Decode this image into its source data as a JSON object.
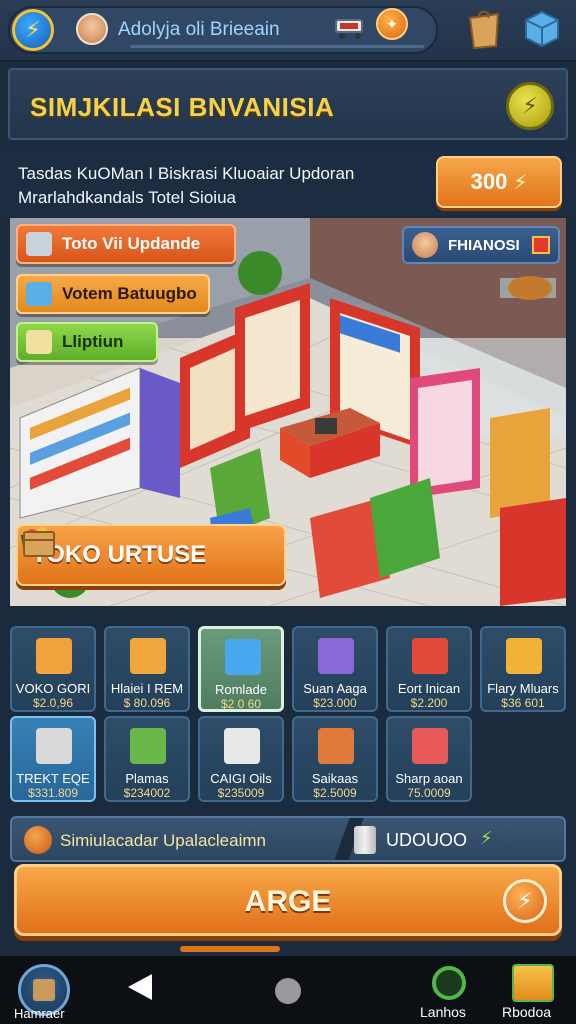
{
  "topbar": {
    "user_name": "Adolyja oli Brieeain",
    "coin_glyph": "⚡"
  },
  "header": {
    "title": "SIMJKILASI BNVANISIA",
    "badge_glyph": "⚡"
  },
  "info": {
    "line1": "Tasdas KuOMan I Biskrasi Kluoaiar Updoran",
    "line2": "Mrarlahdkandals Totel Sioiua",
    "price": "300",
    "price_glyph": "⚡"
  },
  "scene": {
    "buttons": [
      {
        "label": "Toto Vii Updande"
      },
      {
        "label": "Votem Batuugbo"
      },
      {
        "label": "Lliptiun"
      }
    ],
    "friend_label": "FHIANOSI",
    "toko_label": "TOKO URTUSE"
  },
  "items": [
    {
      "name": "VOKO GORI",
      "price": "$2.0,96",
      "color": "#f2a23a"
    },
    {
      "name": "Hlaiei I REM",
      "price": "$ 80.096",
      "color": "#f0a63a"
    },
    {
      "name": "Romlade",
      "price": "$2 0 60",
      "color": "#4aa8f0"
    },
    {
      "name": "Suan Aaga",
      "price": "$23.000",
      "color": "#8a6ad8"
    },
    {
      "name": "Eort Inican",
      "price": "$2.200",
      "color": "#e24a3a"
    },
    {
      "name": "Flary Mluars",
      "price": "$36 601",
      "color": "#f2b23a"
    },
    {
      "name": "TREKT EQE",
      "price": "$331.809",
      "color": "#d9d9d9"
    },
    {
      "name": "Plamas",
      "price": "$234002",
      "color": "#6ab84a"
    },
    {
      "name": "CAIGI Oils",
      "price": "$235009",
      "color": "#e8e8e8"
    },
    {
      "name": "Saikaas",
      "price": "$2.5009",
      "color": "#e07a3a"
    },
    {
      "name": "Sharp aoan",
      "price": "75.0009",
      "color": "#e85a5a"
    }
  ],
  "sim_bar": {
    "label": "Simiulacadar Upalacleaimn",
    "right_label": "UDOUOO",
    "right_glyph": "⚡"
  },
  "big_button": {
    "label": "ARGE",
    "glyph": "⚡"
  },
  "nav": {
    "home_label": "Hamraer",
    "lanhos_label": "Lanhos",
    "rb_label": "Rbodoa"
  }
}
